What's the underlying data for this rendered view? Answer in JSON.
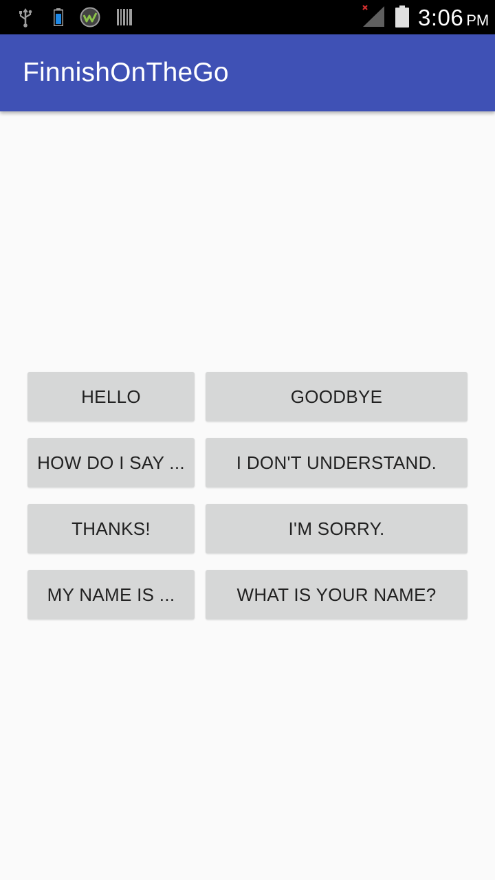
{
  "status_bar": {
    "time": "3:06",
    "ampm": "PM",
    "icons": [
      "usb-icon",
      "battery-small-icon",
      "app-badge-icon",
      "barcode-icon",
      "signal-icon",
      "battery-icon"
    ]
  },
  "app_bar": {
    "title": "FinnishOnTheGo",
    "color": "#3f51b5"
  },
  "phrases": [
    "HELLO",
    "GOODBYE",
    "HOW DO I SAY ...",
    "I DON'T UNDERSTAND.",
    "THANKS!",
    "I'M SORRY.",
    "MY NAME IS ...",
    "WHAT IS YOUR NAME?"
  ],
  "colors": {
    "background": "#fafafa",
    "button": "#d6d7d7",
    "button_text": "#212121"
  }
}
